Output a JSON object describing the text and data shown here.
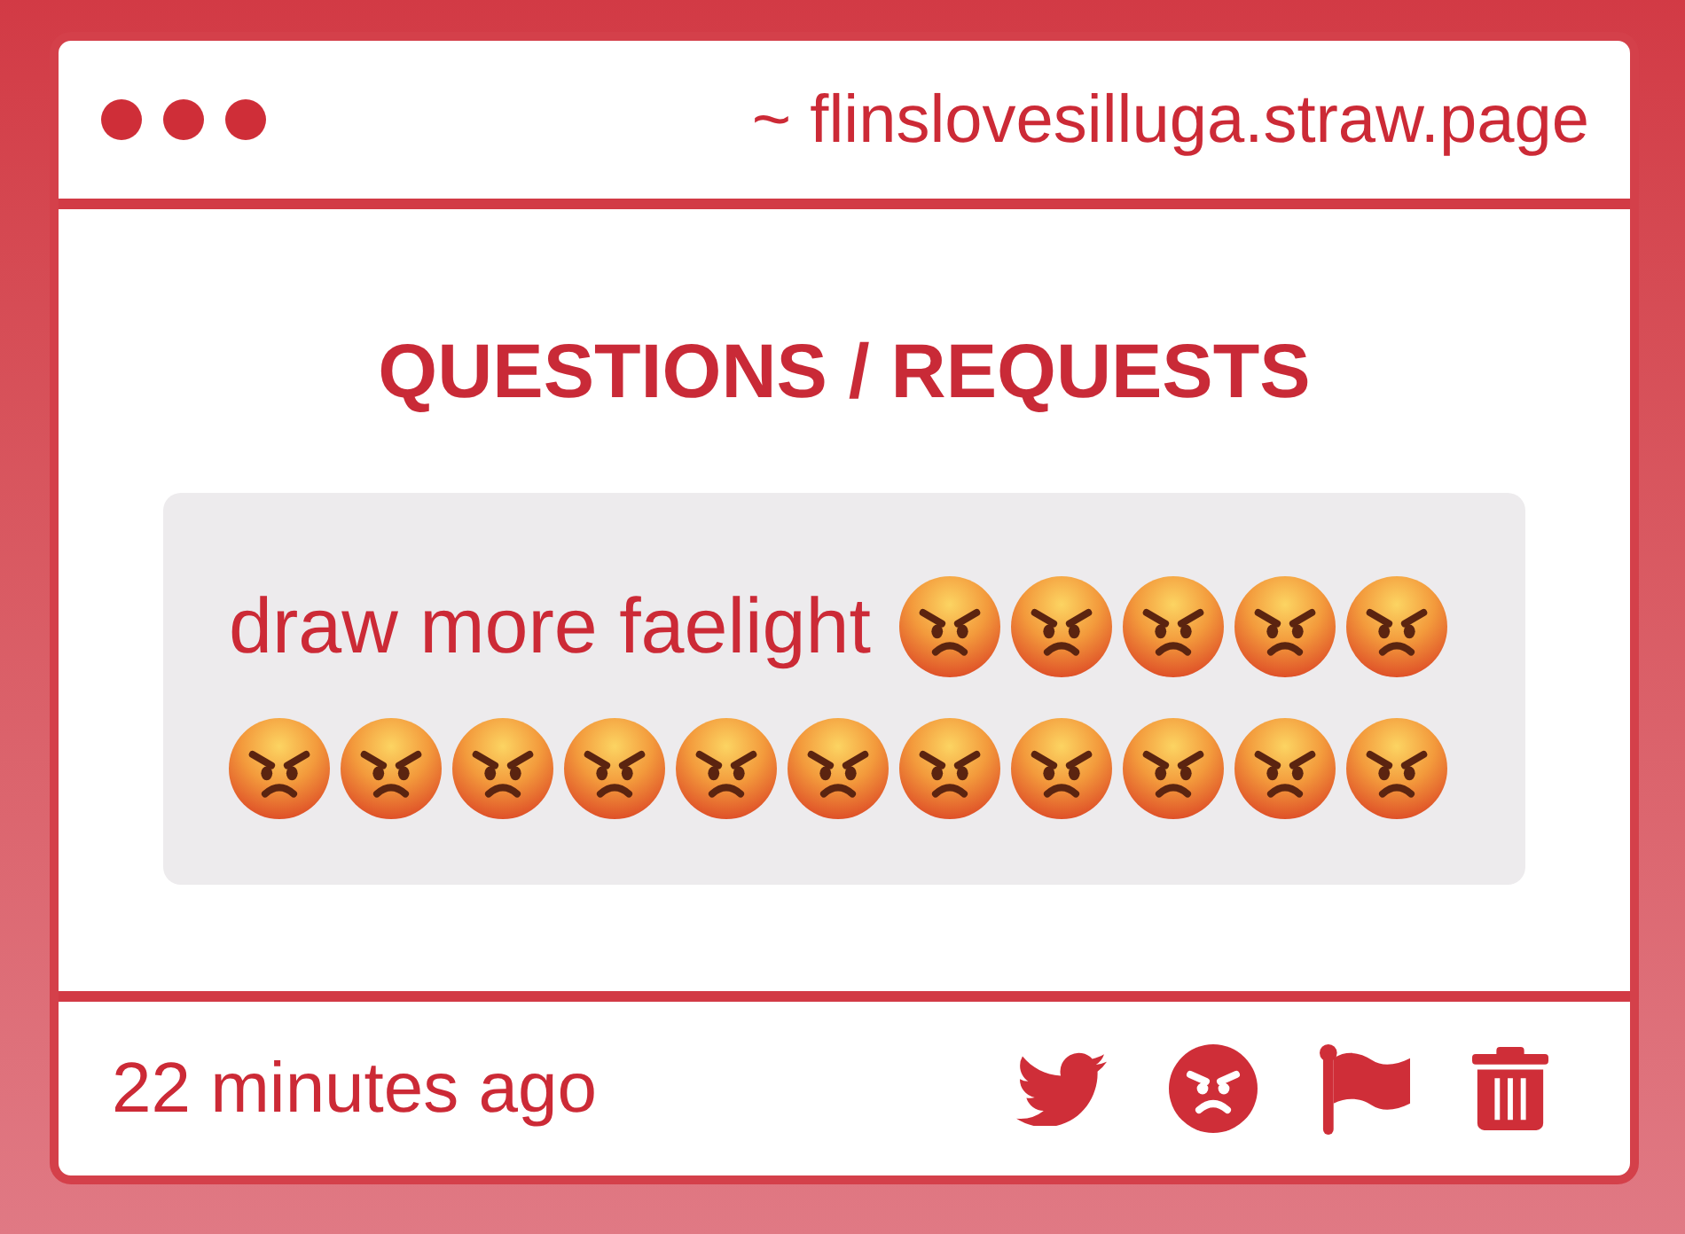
{
  "header": {
    "url": "~ flinslovesilluga.straw.page"
  },
  "title": "QUESTIONS / REQUESTS",
  "message": [
    {
      "kind": "text",
      "text": "draw more faelight"
    },
    {
      "kind": "emoji"
    },
    {
      "kind": "emoji"
    },
    {
      "kind": "emoji"
    },
    {
      "kind": "emoji"
    },
    {
      "kind": "emoji"
    },
    {
      "kind": "emoji"
    },
    {
      "kind": "emoji"
    },
    {
      "kind": "emoji"
    },
    {
      "kind": "emoji"
    },
    {
      "kind": "emoji"
    },
    {
      "kind": "emoji"
    },
    {
      "kind": "emoji"
    },
    {
      "kind": "emoji"
    },
    {
      "kind": "emoji"
    },
    {
      "kind": "emoji"
    },
    {
      "kind": "emoji"
    }
  ],
  "footer": {
    "time": "22 minutes ago"
  }
}
